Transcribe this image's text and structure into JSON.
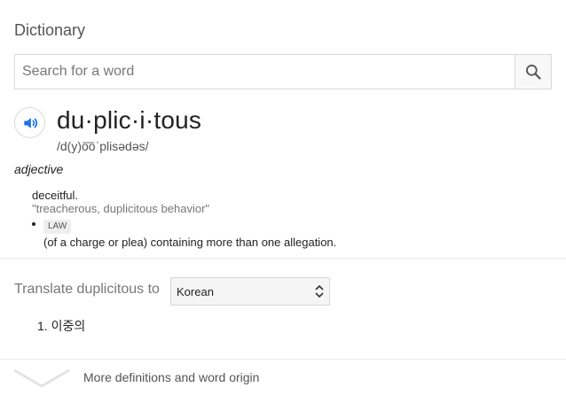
{
  "card": {
    "title": "Dictionary"
  },
  "search": {
    "placeholder": "Search for a word",
    "value": "",
    "button_icon": "search-icon"
  },
  "entry": {
    "speaker_icon": "speaker-icon",
    "headword": "du·plic·i·tous",
    "phonetic": "/d(y)o͞oˈplisədəs/",
    "part_of_speech": "adjective",
    "senses": [
      {
        "definition": "deceitful.",
        "example": "\"treacherous, duplicitous behavior\""
      },
      {
        "tag": "LAW",
        "definition": "(of a charge or plea) containing more than one allegation."
      }
    ]
  },
  "translate": {
    "label": "Translate duplicitous to",
    "selected_language": "Korean",
    "results": [
      {
        "number": "1.",
        "text": "이중의"
      }
    ]
  },
  "footer": {
    "more_label": "More definitions and word origin",
    "chevron_icon": "chevron-down-icon"
  },
  "colors": {
    "accent": "#1a73e8",
    "muted_text": "#777777",
    "border": "#d9d9d9"
  }
}
